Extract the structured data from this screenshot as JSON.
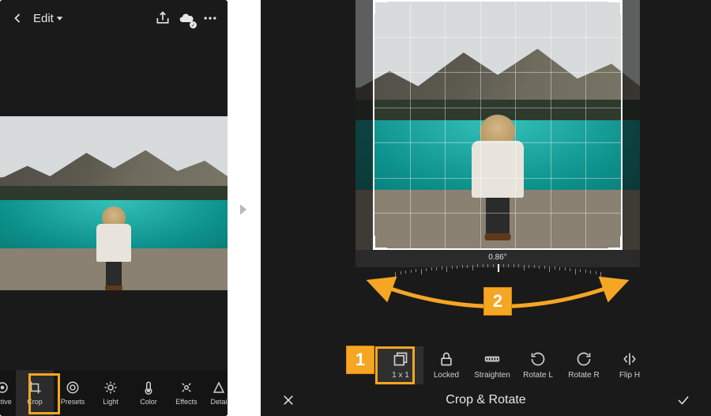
{
  "left_panel": {
    "back_icon": "chevron-left",
    "edit_label": "Edit",
    "share_icon": "share",
    "cloud_icon": "cloud-check",
    "more_icon": "more-horizontal",
    "toolbar": [
      {
        "id": "selective",
        "label": "ective",
        "icon": "target"
      },
      {
        "id": "crop",
        "label": "Crop",
        "icon": "crop",
        "active": true
      },
      {
        "id": "presets",
        "label": "Presets",
        "icon": "lens"
      },
      {
        "id": "light",
        "label": "Light",
        "icon": "sun"
      },
      {
        "id": "color",
        "label": "Color",
        "icon": "thermometer"
      },
      {
        "id": "effects",
        "label": "Effects",
        "icon": "sparkle"
      },
      {
        "id": "detail",
        "label": "Detai",
        "icon": "triangle"
      }
    ]
  },
  "right_panel": {
    "angle_readout": "0.86°",
    "callouts": {
      "one": "1",
      "two": "2"
    },
    "crop_tools": [
      {
        "id": "aspect",
        "label": "1 x 1",
        "icon": "aspect",
        "active": true
      },
      {
        "id": "locked",
        "label": "Locked",
        "icon": "lock"
      },
      {
        "id": "straighten",
        "label": "Straighten",
        "icon": "level"
      },
      {
        "id": "rotatel",
        "label": "Rotate L",
        "icon": "rotate-ccw"
      },
      {
        "id": "rotater",
        "label": "Rotate R",
        "icon": "rotate-cw"
      },
      {
        "id": "fliph",
        "label": "Flip H",
        "icon": "flip-h"
      }
    ],
    "bottom_bar": {
      "cancel_icon": "close",
      "title": "Crop & Rotate",
      "confirm_icon": "check"
    }
  }
}
